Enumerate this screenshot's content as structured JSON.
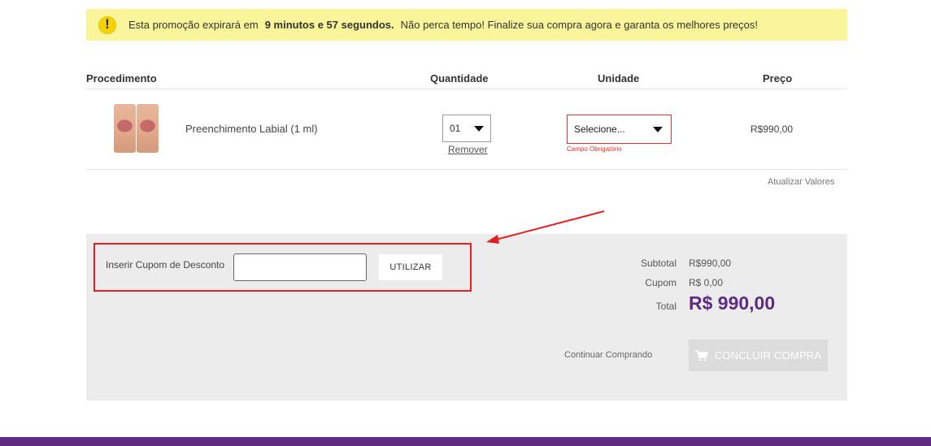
{
  "promo": {
    "text_before": "Esta promoção expirará em",
    "time": "9 minutos e 57 segundos.",
    "text_after": "Não perca tempo! Finalize sua compra agora e garanta os melhores preços!",
    "icon": "exclamation-icon"
  },
  "table": {
    "headers": {
      "procedure": "Procedimento",
      "quantity": "Quantidade",
      "unit": "Unidade",
      "price": "Preço"
    },
    "row": {
      "name": "Preenchimento Labial (1 ml)",
      "quantity": "01",
      "remove": "Remover",
      "unit_placeholder": "Selecione...",
      "unit_error": "Campo Obrigatório",
      "price": "R$990,00"
    },
    "update_values": "Atualizar Valores"
  },
  "coupon": {
    "label": "Inserir Cupom de Desconto",
    "value": "",
    "button": "UTILIZAR"
  },
  "summary": {
    "subtotal_label": "Subtotal",
    "subtotal_value": "R$990,00",
    "coupon_label": "Cupom",
    "coupon_value": "R$ 0,00",
    "total_label": "Total",
    "total_value": "R$ 990,00"
  },
  "actions": {
    "continue": "Continuar Comprando",
    "checkout": "CONCLUIR COMPRA"
  },
  "colors": {
    "brand_purple": "#5e2a82",
    "promo_bg": "#faf59a",
    "error_red": "#e03030",
    "panel_bg": "#ececec"
  }
}
